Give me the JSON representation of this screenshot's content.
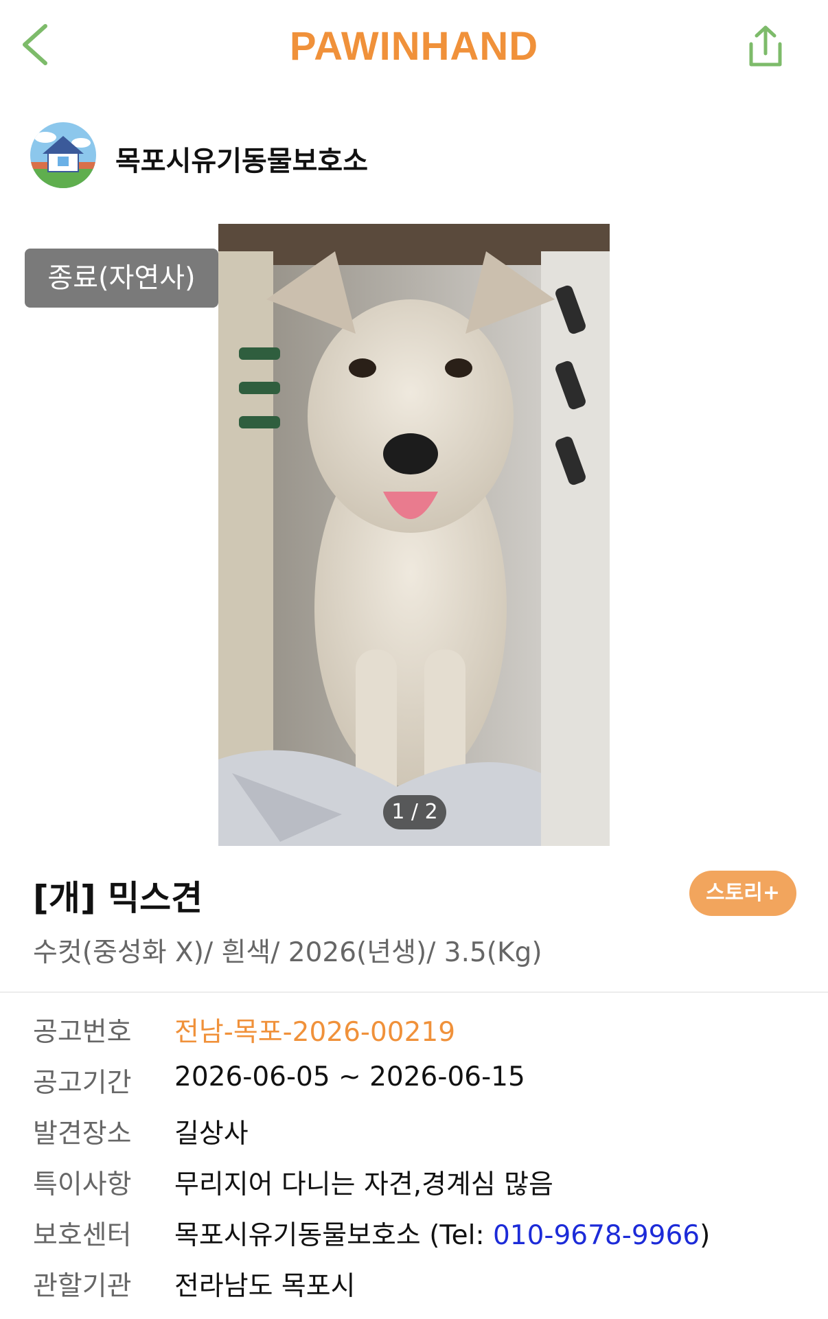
{
  "header": {
    "title": "PAWINHAND",
    "accent_color": "#f0913a",
    "icon_color": "#7dbb6a",
    "back_icon": "chevron-left-icon",
    "share_icon": "share-icon"
  },
  "shelter": {
    "name": "목포시유기동물보호소",
    "avatar_icon": "house-icon"
  },
  "status_badge": "종료(자연사)",
  "photo": {
    "counter": "1 / 2"
  },
  "animal": {
    "title": "[개] 믹스견",
    "summary": "수컷(중성화 X)/ 흰색/ 2026(년생)/ 3.5(Kg)",
    "story_button": "스토리+"
  },
  "details": {
    "notice_no": {
      "label": "공고번호",
      "value": "전남-목포-2026-00219"
    },
    "notice_period": {
      "label": "공고기간",
      "value": "2026-06-05 ~ 2026-06-15"
    },
    "found_place": {
      "label": "발견장소",
      "value": "길상사"
    },
    "notes": {
      "label": "특이사항",
      "value": "무리지어 다니는 자견,경계심 많음"
    },
    "shelter_center": {
      "label": "보호센터",
      "value_prefix": "목포시유기동물보호소 (Tel: ",
      "phone": "010-9678-9966",
      "value_suffix": ")"
    },
    "jurisdiction": {
      "label": "관할기관",
      "value": "전라남도 목포시"
    }
  }
}
